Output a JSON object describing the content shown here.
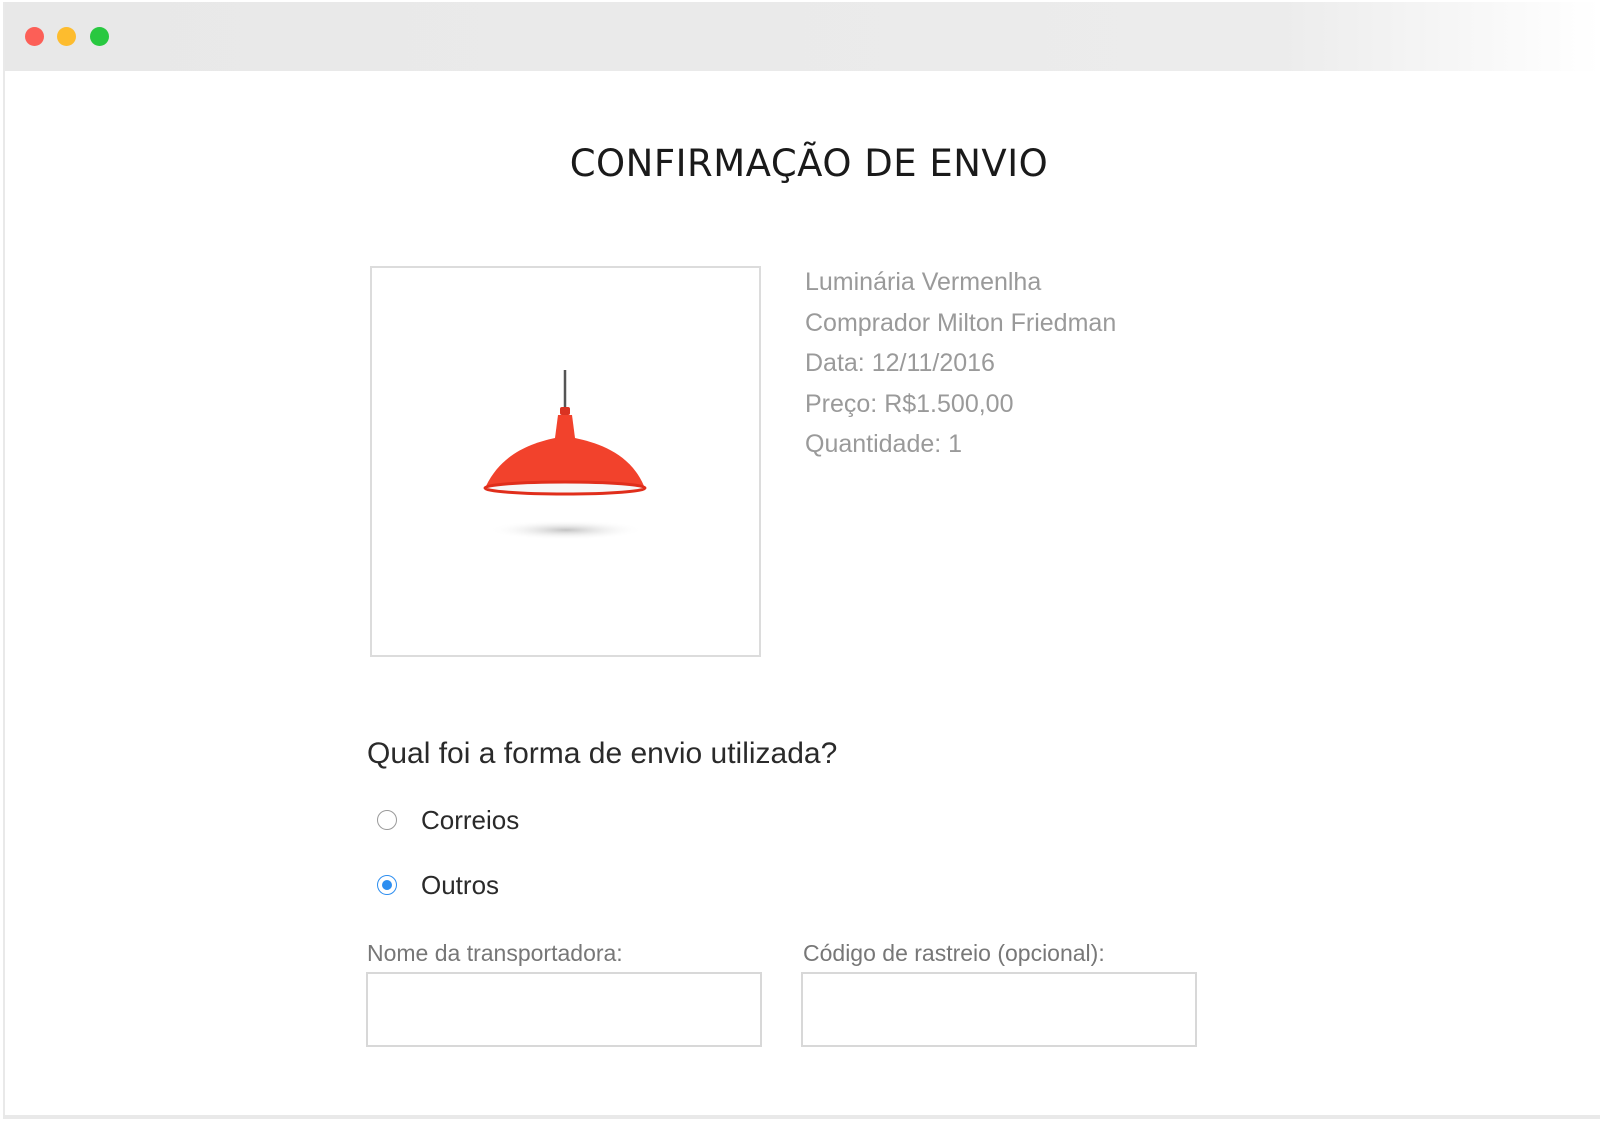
{
  "window": {
    "controls": [
      {
        "name": "close",
        "color": "#fc5f57"
      },
      {
        "name": "minimize",
        "color": "#fdbc2e"
      },
      {
        "name": "maximize",
        "color": "#28c840"
      }
    ]
  },
  "page": {
    "title": "CONFIRMAÇÃO DE ENVIO"
  },
  "product": {
    "image_icon": "red-pendant-lamp",
    "lamp_color": "#f2422c",
    "name": "Luminária Vermenlha",
    "buyer": "Comprador Milton Friedman",
    "date": "Data: 12/11/2016",
    "price": "Preço: R$1.500,00",
    "quantity": "Quantidade: 1"
  },
  "shipping": {
    "question": "Qual foi a forma de envio utilizada?",
    "options": [
      {
        "label": "Correios",
        "selected": false
      },
      {
        "label": "Outros",
        "selected": true
      }
    ],
    "accent_color": "#2d8ef0",
    "carrier_label": "Nome da transportadora:",
    "carrier_value": "",
    "tracking_label": "Código de rastreio (opcional):",
    "tracking_value": ""
  }
}
